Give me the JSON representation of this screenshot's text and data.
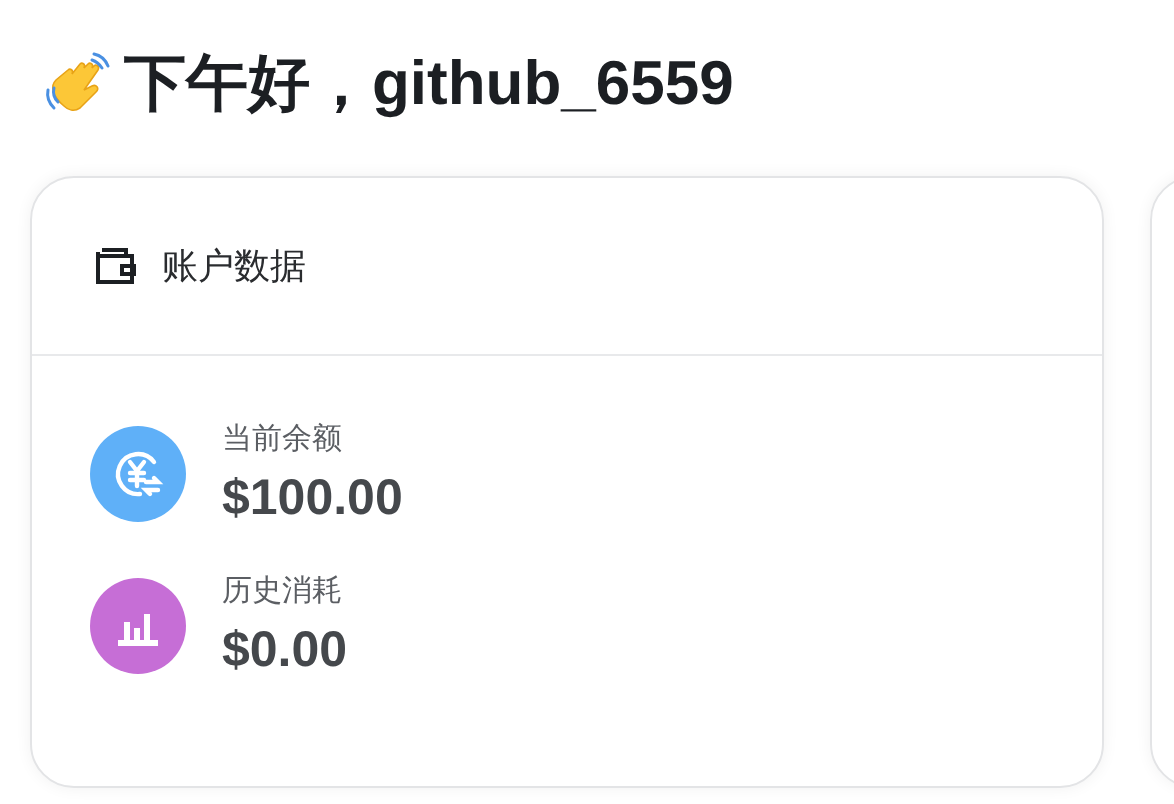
{
  "greeting": "下午好，github_6559",
  "cards": [
    {
      "title": "账户数据",
      "stats": [
        {
          "kind": "balance",
          "color": "#5fb0f8",
          "label": "当前余额",
          "value": "$100.00"
        },
        {
          "kind": "usage",
          "color": "#c66ed6",
          "label": "历史消耗",
          "value": "$0.00"
        }
      ]
    }
  ]
}
